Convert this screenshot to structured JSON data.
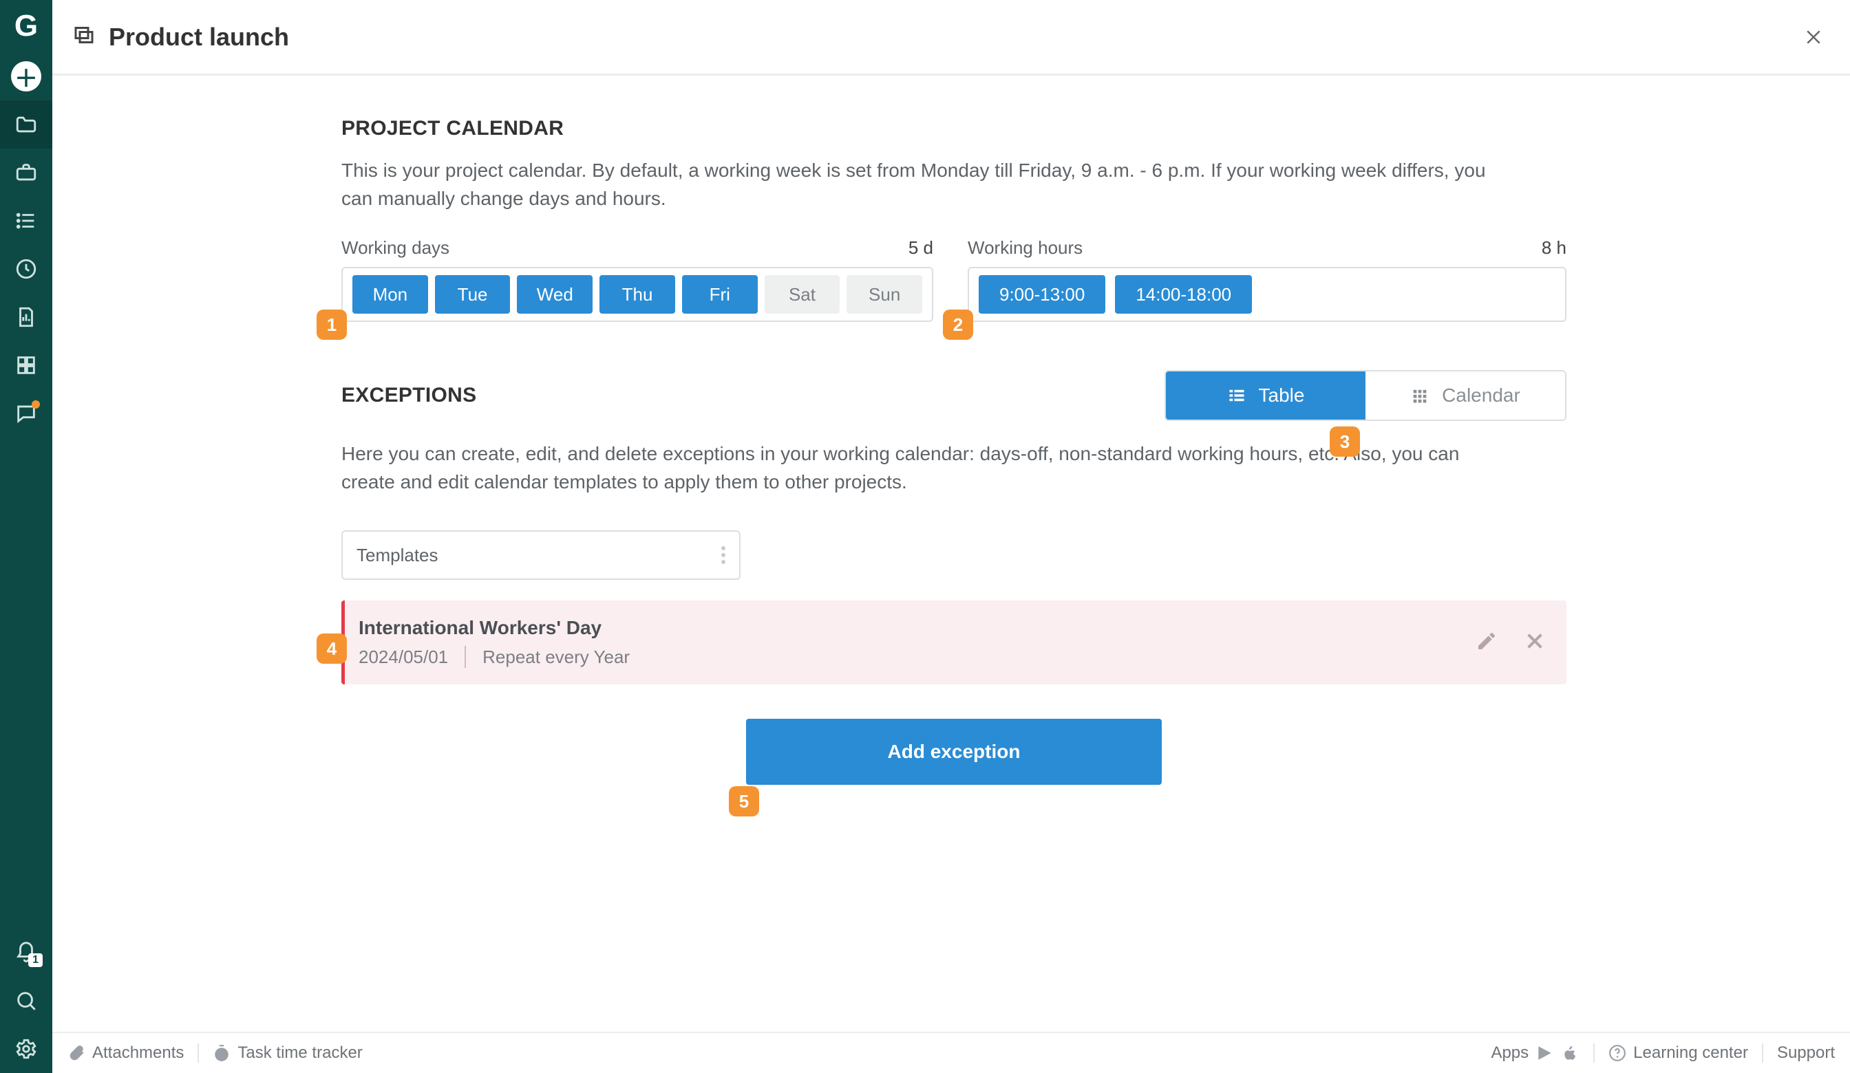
{
  "header": {
    "title": "Product launch"
  },
  "calendar": {
    "section_title": "PROJECT CALENDAR",
    "description": "This is your project calendar. By default, a working week is set from Monday till Friday, 9 a.m. - 6 p.m. If your working week differs, you can manually change days and hours.",
    "working_days": {
      "label": "Working days",
      "summary": "5 d",
      "days": [
        {
          "label": "Mon",
          "active": true
        },
        {
          "label": "Tue",
          "active": true
        },
        {
          "label": "Wed",
          "active": true
        },
        {
          "label": "Thu",
          "active": true
        },
        {
          "label": "Fri",
          "active": true
        },
        {
          "label": "Sat",
          "active": false
        },
        {
          "label": "Sun",
          "active": false
        }
      ]
    },
    "working_hours": {
      "label": "Working hours",
      "summary": "8 h",
      "ranges": [
        "9:00-13:00",
        "14:00-18:00"
      ]
    }
  },
  "exceptions": {
    "section_title": "EXCEPTIONS",
    "description": "Here you can create, edit, and delete exceptions in your working calendar: days-off, non-standard working hours, etc. Also, you can create and edit calendar templates to apply them to other projects.",
    "view_switch": {
      "table": "Table",
      "calendar": "Calendar"
    },
    "templates_label": "Templates",
    "list": [
      {
        "title": "International Workers' Day",
        "date": "2024/05/01",
        "repeat": "Repeat every Year"
      }
    ],
    "add_label": "Add exception"
  },
  "footer": {
    "attachments": "Attachments",
    "tracker": "Task time tracker",
    "apps": "Apps",
    "learning_center": "Learning center",
    "support": "Support"
  },
  "markers": [
    "1",
    "2",
    "3",
    "4",
    "5"
  ]
}
